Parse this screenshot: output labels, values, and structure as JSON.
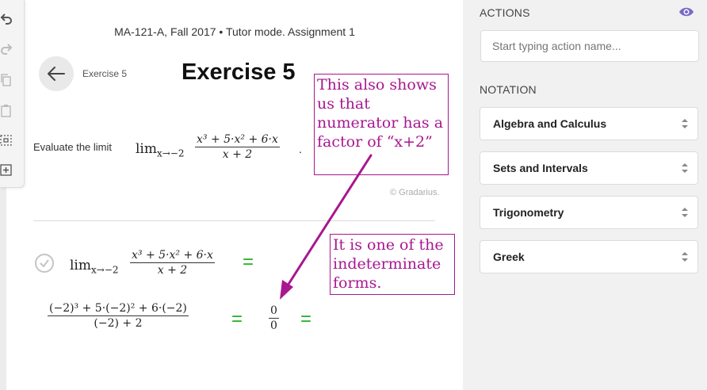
{
  "header": {
    "course": "MA-121-A, Fall 2017 • Tutor mode. Assignment 1",
    "exercise_small": "Exercise 5",
    "exercise_title": "Exercise 5"
  },
  "problem": {
    "prompt": "Evaluate the limit",
    "lim": "lim",
    "lim_sub": "x→−2",
    "numerator": "x³ + 5·x² + 6·x",
    "denominator": "x + 2",
    "period": ".",
    "copyright": "© Gradarius."
  },
  "work": {
    "lim": "lim",
    "lim_sub": "x→−2",
    "numerator": "x³ + 5·x² + 6·x",
    "denominator": "x + 2",
    "eq1": "=",
    "subst_numerator": "(−2)³ + 5·(−2)² + 6·(−2)",
    "subst_denominator": "(−2) + 2",
    "eq2": "=",
    "result_num": "0",
    "result_den": "0",
    "eq3": "="
  },
  "annotations": {
    "note1": "This also shows us that numerator has a factor of “x+2”",
    "note2": "It is one of the indeterminate forms.",
    "color": "#a8178f"
  },
  "sidebar": {
    "actions_label": "ACTIONS",
    "action_placeholder": "Start typing action name...",
    "notation_label": "NOTATION",
    "selects": [
      "Algebra and Calculus",
      "Sets and Intervals",
      "Trigonometry",
      "Greek"
    ],
    "eye_color": "#6a5acd"
  },
  "toolbar": {
    "icons": [
      "undo-icon",
      "redo-icon",
      "copy-icon",
      "paste-icon",
      "select-box-icon",
      "add-box-icon"
    ]
  },
  "colors": {
    "equals": "#22b022",
    "annotation": "#a8178f"
  }
}
